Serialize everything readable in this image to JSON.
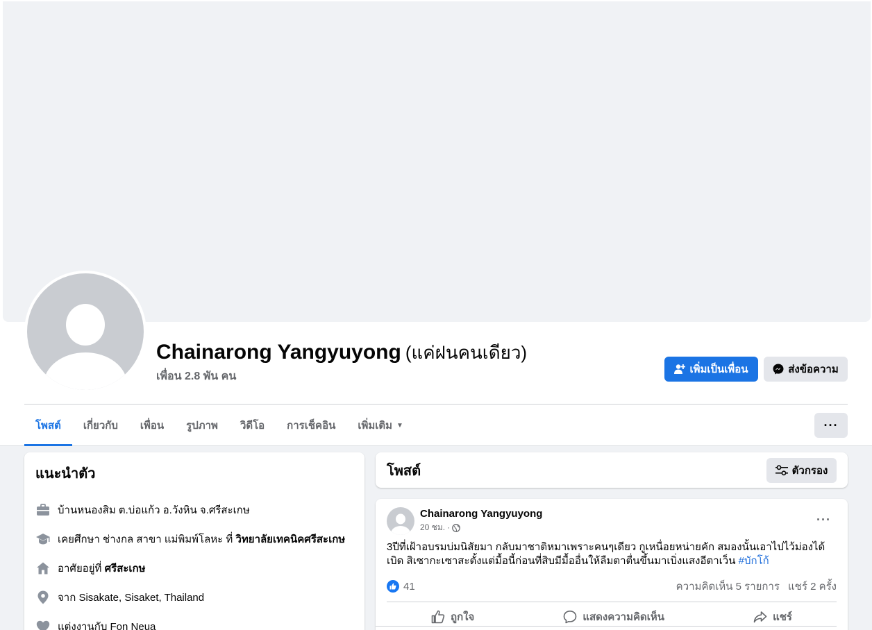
{
  "profile": {
    "name": "Chainarong Yangyuyong",
    "alt_name": "(แค่ฝนคนเดียว)",
    "friends": "เพื่อน 2.8 พัน คน",
    "add_friend_label": "เพิ่มเป็นเพื่อน",
    "message_label": "ส่งข้อความ"
  },
  "tabs": [
    {
      "label": "โพสต์"
    },
    {
      "label": "เกี่ยวกับ"
    },
    {
      "label": "เพื่อน"
    },
    {
      "label": "รูปภาพ"
    },
    {
      "label": "วิดีโอ"
    },
    {
      "label": "การเช็คอิน"
    },
    {
      "label": "เพิ่มเติม"
    }
  ],
  "more_label": "···",
  "intro": {
    "title": "แนะนำตัว",
    "items": [
      {
        "icon": "briefcase-icon",
        "text": "บ้านหนองสิม ต.บ่อแก้ว อ.วังหิน จ.ศรีสะเกษ",
        "bold": ""
      },
      {
        "icon": "graduation-cap-icon",
        "text": "เคยศึกษา ช่างกล สาขา แม่พิมพ์โลหะ ที่ ",
        "bold": "วิทยาลัยเทคนิคศรีสะเกษ"
      },
      {
        "icon": "home-icon",
        "text": "อาศัยอยู่ที่ ",
        "bold": "ศรีสะเกษ"
      },
      {
        "icon": "location-pin-icon",
        "text": "จาก Sisakate, Sisaket, Thailand",
        "bold": ""
      },
      {
        "icon": "heart-icon",
        "text": "แต่งงานกับ Fon Neua",
        "bold": ""
      }
    ]
  },
  "posts_header": {
    "title": "โพสต์",
    "filter_label": "ตัวกรอง"
  },
  "post": {
    "author": "Chainarong Yangyuyong",
    "time": "20 ชม. ·",
    "dots": "···",
    "text": "3ปีที่เฝ้าอบรมบ่มนิสัยมา กลับมาชาติหมาเพราะคนๆเดียว กูเหนื่อยหน่ายคัก สมองนั้นเอาไปไว้ม่องได้เบิด สิเซากะเซาสะตั้งแต่มื้อนี้ก่อนที่สิบมีมื้ออื่นให้ลืมตาตื่นขึ้นมาเบิ่งแสงอีตาเว็น ",
    "hashtag": "#บักโก้",
    "likes": "41",
    "comments": "ความคิดเห็น 5 รายการ",
    "shares": "แชร์ 2 ครั้ง",
    "like_label": "ถูกใจ",
    "comment_label": "แสดงความคิดเห็น",
    "share_label": "แชร์"
  },
  "colors": {
    "accent": "#1b74e4",
    "hashtag": "#216fdb",
    "secondary_text": "#65676b"
  }
}
